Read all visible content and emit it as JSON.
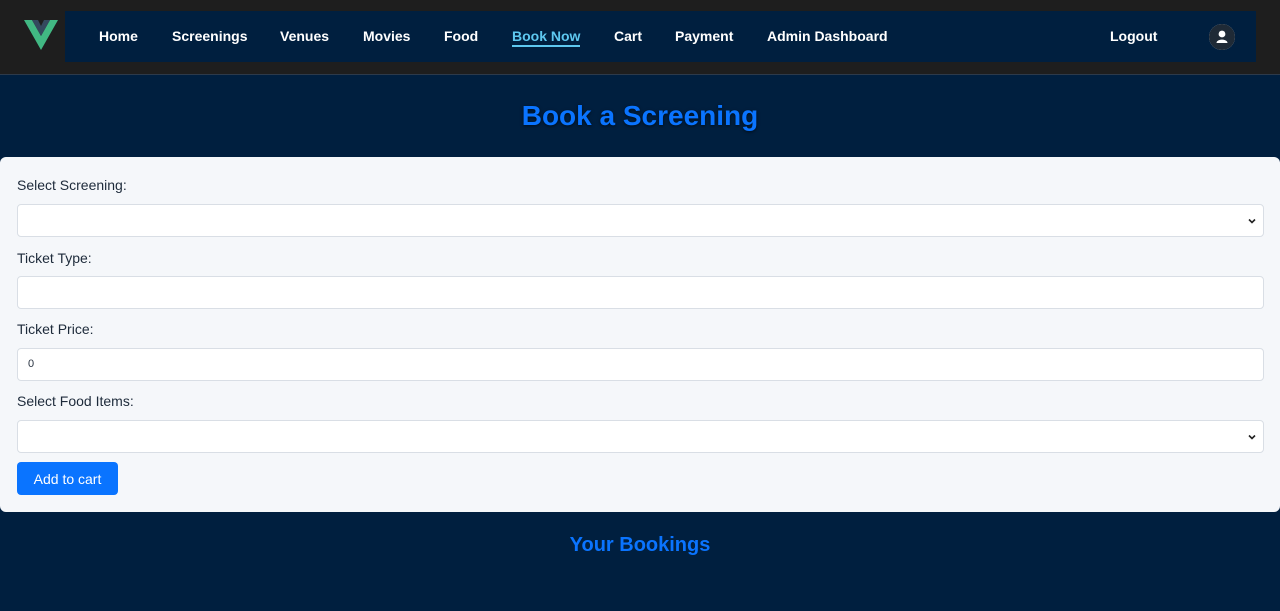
{
  "nav": {
    "items": [
      {
        "label": "Home",
        "active": false
      },
      {
        "label": "Screenings",
        "active": false
      },
      {
        "label": "Venues",
        "active": false
      },
      {
        "label": "Movies",
        "active": false
      },
      {
        "label": "Food",
        "active": false
      },
      {
        "label": "Book Now",
        "active": true
      },
      {
        "label": "Cart",
        "active": false
      },
      {
        "label": "Payment",
        "active": false
      },
      {
        "label": "Admin Dashboard",
        "active": false
      }
    ],
    "logout_label": "Logout",
    "logo_icon": "vue-logo-icon",
    "avatar_icon": "user-icon"
  },
  "page": {
    "title": "Book a Screening"
  },
  "form": {
    "screening_label": "Select Screening:",
    "screening_value": "",
    "ticket_type_label": "Ticket Type:",
    "ticket_type_value": "",
    "ticket_price_label": "Ticket Price:",
    "ticket_price_value": "0",
    "food_label": "Select Food Items:",
    "food_value": "",
    "add_to_cart_label": "Add to cart"
  },
  "bookings": {
    "title": "Your Bookings"
  },
  "colors": {
    "background": "#001f3f",
    "accent": "#0a74ff",
    "active_nav": "#5ec8f0",
    "card": "#f5f7fa"
  }
}
